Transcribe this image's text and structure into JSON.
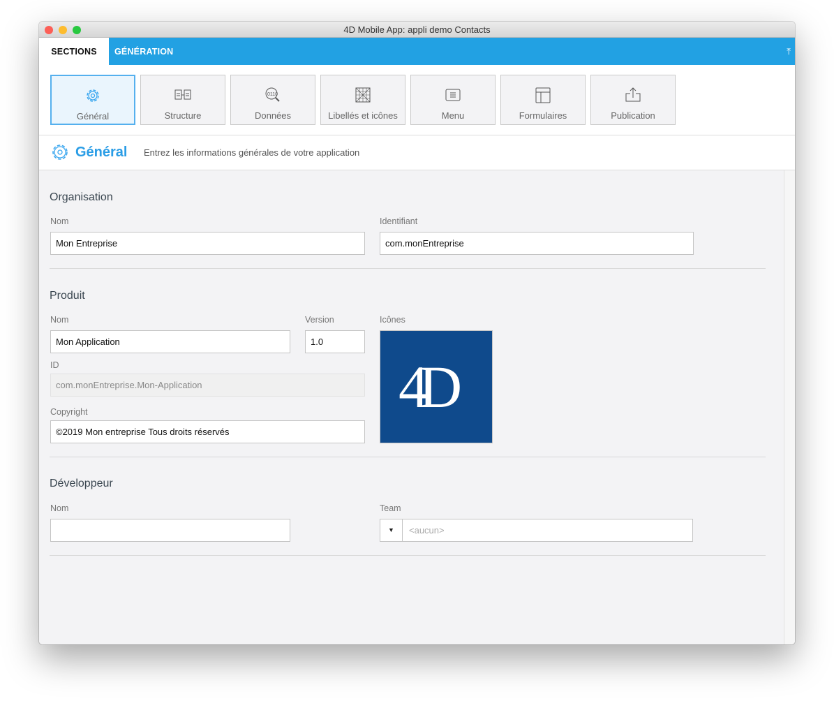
{
  "window": {
    "title": "4D Mobile App: appli demo Contacts"
  },
  "tabs": {
    "sections": "SECTIONS",
    "generation": "GÉNÉRATION"
  },
  "sections": [
    {
      "label": "Général"
    },
    {
      "label": "Structure"
    },
    {
      "label": "Données"
    },
    {
      "label": "Libellés et icônes"
    },
    {
      "label": "Menu"
    },
    {
      "label": "Formulaires"
    },
    {
      "label": "Publication"
    }
  ],
  "header": {
    "title": "Général",
    "subtitle": "Entrez les informations générales de votre application"
  },
  "organisation": {
    "title": "Organisation",
    "nom_label": "Nom",
    "nom_value": "Mon Entreprise",
    "id_label": "Identifiant",
    "id_value": "com.monEntreprise"
  },
  "produit": {
    "title": "Produit",
    "nom_label": "Nom",
    "nom_value": "Mon Application",
    "version_label": "Version",
    "version_value": "1.0",
    "icones_label": "Icônes",
    "icon_text": "4D",
    "id_label": "ID",
    "id_value": "com.monEntreprise.Mon-Application",
    "copyright_label": "Copyright",
    "copyright_value": "©2019 Mon entreprise Tous droits réservés"
  },
  "developpeur": {
    "title": "Développeur",
    "nom_label": "Nom",
    "nom_value": "",
    "team_label": "Team",
    "team_placeholder": "<aucun>"
  },
  "colors": {
    "accent": "#22a1e3",
    "logo_bg": "#0f4a8c"
  }
}
